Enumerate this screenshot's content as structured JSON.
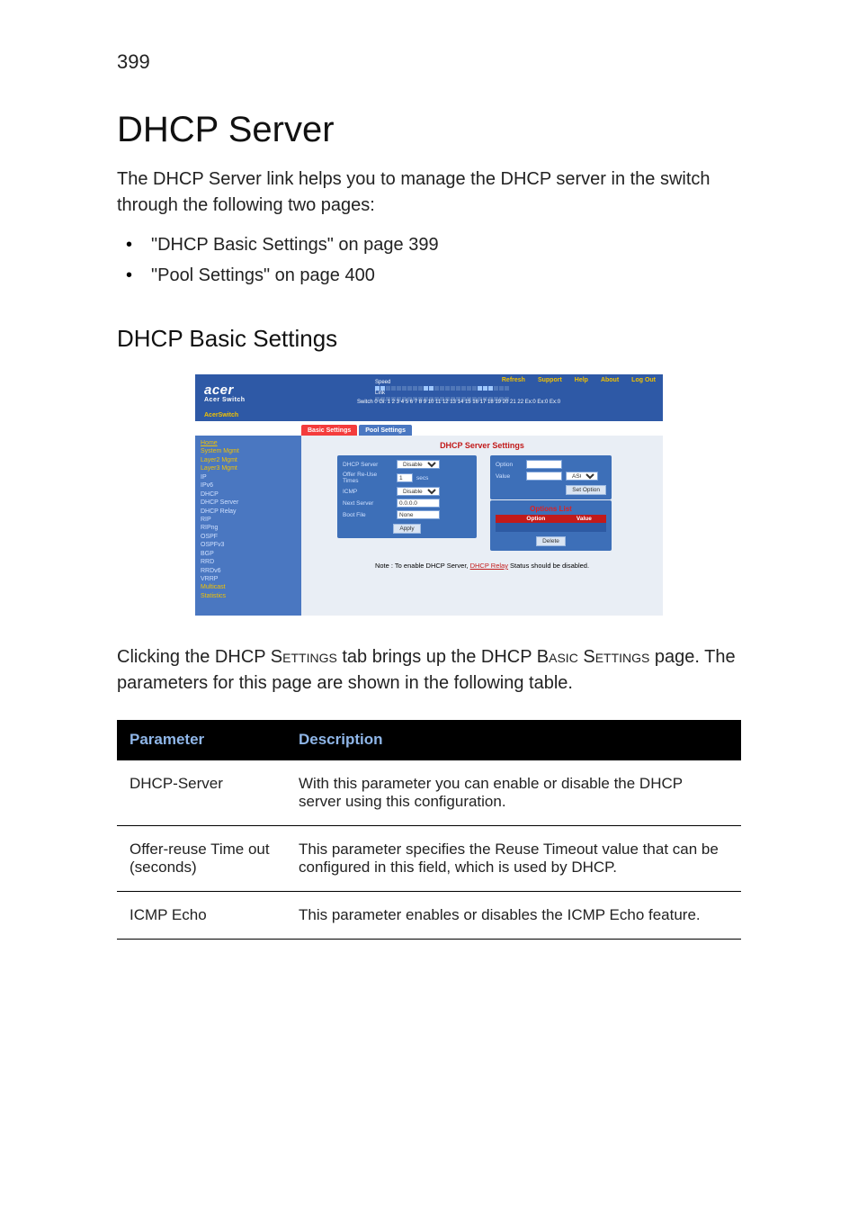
{
  "page_number": "399",
  "title": "DHCP Server",
  "intro": "The DHCP Server link helps you to manage the DHCP server in the switch through the following two pages:",
  "bullets": [
    "\"DHCP Basic Settings\" on page 399",
    "\"Pool Settings\" on page 400"
  ],
  "subheading": "DHCP Basic Settings",
  "screenshot": {
    "brand": "acer",
    "brand_sub": "Acer Switch",
    "toplinks": {
      "refresh": "Refresh",
      "support": "Support",
      "help": "Help",
      "about": "About",
      "logout": "Log Out"
    },
    "port_labels": {
      "speed": "Speed",
      "link": "Link"
    },
    "port_legend": "Switch 0 Gi: 1  2  3  4  5  6  7  8  9 10 11 12 13 14 15 16 17 18 19 20 21 22 Ex:0 Ex:0 Ex:0",
    "barlabel": "AcerSwitch",
    "tabs": {
      "basic": "Basic Settings",
      "pool": "Pool Settings"
    },
    "sidebar": {
      "home": "Home",
      "items": [
        "System Mgmt",
        "Layer2 Mgmt",
        "Layer3 Mgmt",
        "   IP",
        "   IPv6",
        "   DHCP",
        "     DHCP Server",
        "     DHCP Relay",
        "   RIP",
        "   RIPng",
        "   OSPF",
        "   OSPFv3",
        "   BGP",
        "   RRD",
        "   RRDv6",
        "   VRRP",
        "Multicast",
        "Statistics"
      ]
    },
    "content": {
      "heading": "DHCP Server Settings",
      "left_rows": {
        "dhcp_server": "DHCP Server",
        "offer_reuse": "Offer Re-Use Times",
        "icmp": "ICMP",
        "next_server": "Next Server",
        "boot_file": "Boot File"
      },
      "left_values": {
        "dhcp_server": "Disabled",
        "offer_reuse": "1",
        "offer_reuse_unit": "secs",
        "icmp": "Disabled",
        "next_server": "0.0.0.0",
        "boot_file": "None"
      },
      "apply_btn": "Apply",
      "right": {
        "option_label": "Option",
        "value_label": "Value",
        "value_mode": "ASCII",
        "set_btn": "Set Option",
        "options_list_title": "Options List",
        "th_option": "Option",
        "th_value": "Value",
        "delete_btn": "Delete"
      },
      "note_prefix": "Note : To enable DHCP Server, ",
      "note_link": "DHCP Relay",
      "note_suffix": " Status should be disabled."
    }
  },
  "after_screenshot": {
    "l1a": "Clicking the DHCP S",
    "l1b": "ettings",
    "l1c": " tab brings up the DHCP B",
    "l1d": "asic ",
    "l1e": "S",
    "l1f": "ettings",
    "l1g": " page. The parameters for this page are shown in the following table."
  },
  "table": {
    "headers": {
      "param": "Parameter",
      "desc": "Description"
    },
    "rows": [
      {
        "param": "DHCP-Server",
        "desc": "With this parameter you can enable or disable the DHCP server using this configuration."
      },
      {
        "param": "Offer-reuse Time out (seconds)",
        "desc": "This parameter specifies the Reuse Timeout value that can be configured in this field, which is used by DHCP."
      },
      {
        "param": "ICMP Echo",
        "desc": "This parameter enables or disables the ICMP Echo feature."
      }
    ]
  }
}
